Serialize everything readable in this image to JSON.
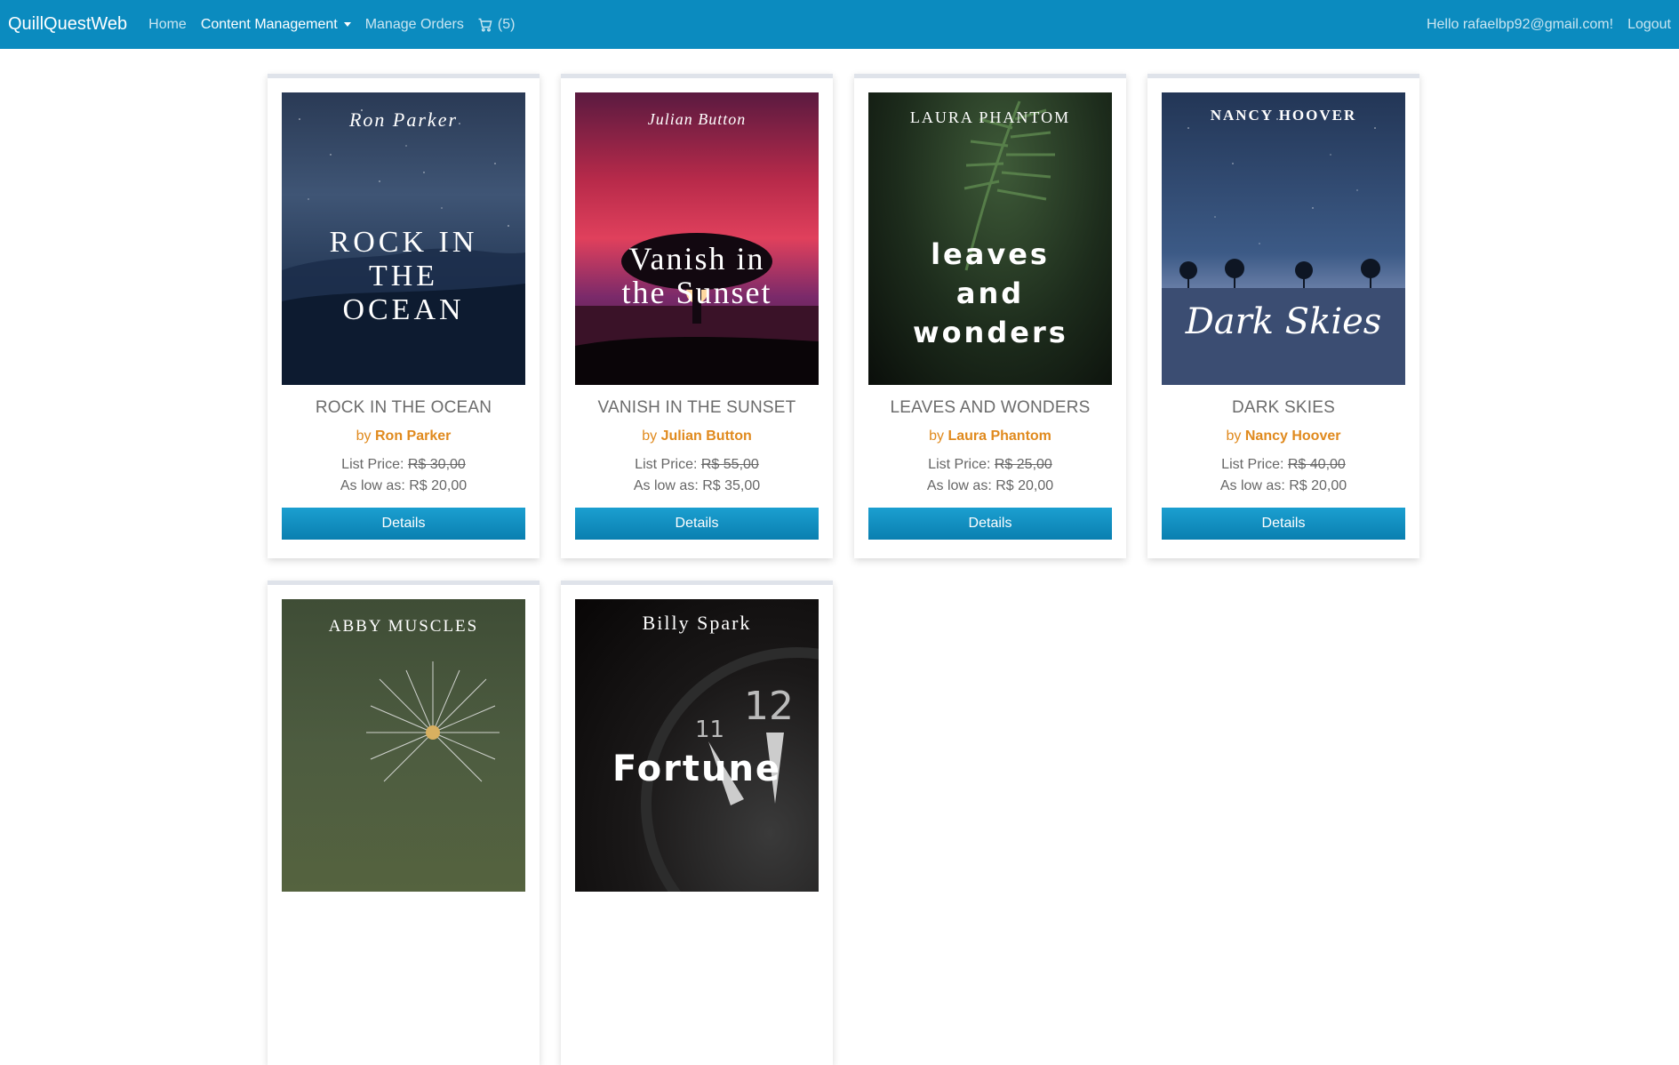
{
  "navbar": {
    "brand": "QuillQuestWeb",
    "home": "Home",
    "content_management": "Content Management",
    "manage_orders": "Manage Orders",
    "cart_count": "(5)",
    "greeting": "Hello rafaelbp92@gmail.com!",
    "logout": "Logout"
  },
  "ui": {
    "details_label": "Details",
    "list_price_label": "List Price:",
    "as_low_as_label": "As low as:",
    "by_label": "by"
  },
  "products": [
    {
      "title": "ROCK IN THE OCEAN",
      "author": "Ron Parker",
      "list_price": "R$ 30,00",
      "low_price": "R$ 20,00",
      "cover_author": "Ron Parker",
      "cover_title": "ROCK IN THE OCEAN"
    },
    {
      "title": "VANISH IN THE SUNSET",
      "author": "Julian Button",
      "list_price": "R$ 55,00",
      "low_price": "R$ 35,00",
      "cover_author": "Julian Button",
      "cover_title": "Vanish in the Sunset"
    },
    {
      "title": "LEAVES AND WONDERS",
      "author": "Laura Phantom",
      "list_price": "R$ 25,00",
      "low_price": "R$ 20,00",
      "cover_author": "LAURA PHANTOM",
      "cover_title": "leaves and wonders"
    },
    {
      "title": "DARK SKIES",
      "author": "Nancy Hoover",
      "list_price": "R$ 40,00",
      "low_price": "R$ 20,00",
      "cover_author": "NANCY HOOVER",
      "cover_title": "Dark Skies"
    },
    {
      "cover_author": "ABBY MUSCLES"
    },
    {
      "cover_author": "Billy Spark",
      "cover_title": "Fortune"
    }
  ]
}
